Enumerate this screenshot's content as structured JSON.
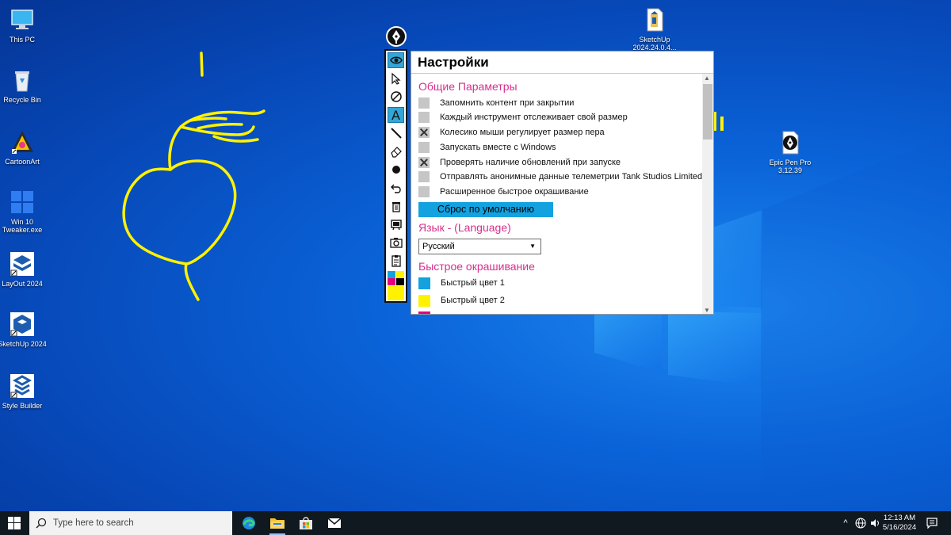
{
  "desktop": {
    "icons": [
      {
        "label": "This PC"
      },
      {
        "label": "Recycle Bin"
      },
      {
        "label": "CartoonArt"
      },
      {
        "label": "Win 10 Tweaker.exe"
      },
      {
        "label": "LayOut 2024"
      },
      {
        "label": "SketchUp 2024"
      },
      {
        "label": "Style Builder"
      },
      {
        "label": "SketchUp 2024.24.0.4..."
      },
      {
        "label": "Epic Pen Pro 3.12.39"
      }
    ]
  },
  "colors": {
    "pen_yellow": "#fff200",
    "accent_cyan": "#13a2df",
    "accent_magenta": "#e4007c",
    "section_pink": "#d62f8e"
  },
  "toolbar": {
    "tools": [
      {
        "icon": "eye-icon",
        "active": true
      },
      {
        "icon": "pointer-icon",
        "active": false
      },
      {
        "icon": "pen-icon",
        "active": false
      },
      {
        "icon": "text-icon",
        "active": true
      },
      {
        "icon": "line-icon",
        "active": false
      },
      {
        "icon": "eraser-icon",
        "active": false
      },
      {
        "icon": "brush-size-icon",
        "active": false
      },
      {
        "icon": "undo-icon",
        "active": false
      },
      {
        "icon": "trash-icon",
        "active": false
      },
      {
        "icon": "whiteboard-icon",
        "active": false
      },
      {
        "icon": "camera-icon",
        "active": false
      },
      {
        "icon": "clipboard-icon",
        "active": false
      },
      {
        "icon": "color-palette-icon",
        "active": false
      },
      {
        "icon": "current-color-icon",
        "active": false
      }
    ]
  },
  "settings": {
    "title": "Настройки",
    "general_heading": "Общие Параметры",
    "options": [
      {
        "label": "Запомнить контент при закрытии",
        "checked": false
      },
      {
        "label": "Каждый инструмент отслеживает свой размер",
        "checked": false
      },
      {
        "label": "Колесико мыши регулирует размер пера",
        "checked": true
      },
      {
        "label": "Запускать вместе с Windows",
        "checked": false
      },
      {
        "label": "Проверять наличие обновлений при запуске",
        "checked": true
      },
      {
        "label": "Отправлять анонимные данные телеметрии Tank Studios Limited",
        "checked": false
      },
      {
        "label": "Расширенное быстрое окрашивание",
        "checked": false
      }
    ],
    "reset_label": "Сброс по умолчанию",
    "language_heading": "Язык - (Language)",
    "language_value": "Русский",
    "quick_color_heading": "Быстрое окрашивание",
    "quick_colors": [
      {
        "label": "Быстрый цвет 1",
        "color": "#13a2df"
      },
      {
        "label": "Быстрый цвет 2",
        "color": "#fff200"
      }
    ]
  },
  "taskbar": {
    "search_placeholder": "Type here to search",
    "apps": [
      "edge-icon",
      "file-explorer-icon",
      "store-icon",
      "mail-icon"
    ],
    "clock_time": "12:13 AM",
    "clock_date": "5/16/2024"
  }
}
